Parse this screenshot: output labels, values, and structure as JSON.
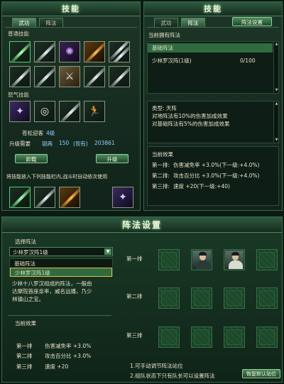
{
  "skills_panel": {
    "title": "技能",
    "tabs": [
      "武功",
      "阵法"
    ],
    "normal_label": "普通技能",
    "rage_label": "怒气技能",
    "skill_name": "苍松迎客",
    "skill_level": "4级",
    "upgrade_label": "升级需要",
    "money_label": "银两",
    "money_need": "150",
    "money_have_label": "(现有)",
    "money_have": "203861",
    "unload_button": "卸载",
    "upgrade_button": "升级",
    "hint": "将技能放入下列技能栏内,战斗时自动依次使用"
  },
  "formation_panel": {
    "title": "技能",
    "tabs": [
      "武功",
      "阵法"
    ],
    "setup_button": "阵法设置",
    "owned_label": "当前拥有阵法",
    "list": [
      {
        "name": "基础阵法",
        "value": ""
      },
      {
        "name": "少林罗汉阵(1级)",
        "value": "0/100"
      }
    ],
    "type_line": "类型: 天阵",
    "effect_line1": "对地阵法有10%的伤害加成效果",
    "effect_line2": "对基础阵法有5%的伤害加成效果",
    "current_effect_label": "当前效果",
    "effects": [
      {
        "row": "第一排:",
        "text": "伤害减免率 +3.0%(下一级:+4.0%)"
      },
      {
        "row": "第二排:",
        "text": "攻击百分比 +3.0%(下一级:+4.0%)"
      },
      {
        "row": "第三排:",
        "text": "速度 +20(下一级:+40)"
      }
    ]
  },
  "setup_dialog": {
    "title": "阵法设置",
    "choose_label": "选择阵法",
    "dropdown_value": "少林罗汉阵1级",
    "options": [
      "基础阵法",
      "少林罗汉阵1级"
    ],
    "description": [
      "少林十八罗汉组成的阵法，一般由",
      "达摩院首座亲率，威名远播，乃少",
      "林镇山之宝。"
    ],
    "current_effect_label": "当前效果",
    "effects": [
      {
        "row": "第一排",
        "text": "伤害减免率 +3.0%"
      },
      {
        "row": "第二排",
        "text": "攻击百分比 +3.0%"
      },
      {
        "row": "第三排",
        "text": "速度 +20"
      }
    ],
    "row_labels": [
      "第一排",
      "第二排",
      "第三排"
    ],
    "notes": [
      "1.可手动调节阵法站位",
      "2.组队状态下只有队长可以设置阵法"
    ],
    "restore_button": "恢复默认站位"
  },
  "colors": {
    "gold": "#e8b84a",
    "highlight_row": "#2f6b3f",
    "accent": "#8fd2a0"
  }
}
